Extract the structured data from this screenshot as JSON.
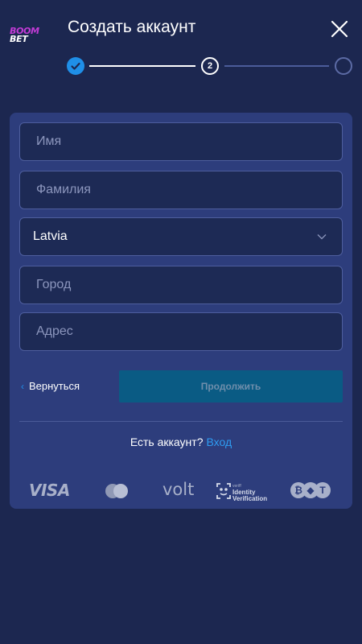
{
  "logo": {
    "line1": "BOOM",
    "line2": "BET"
  },
  "header": {
    "title": "Создать аккаунт",
    "close_icon": "close-icon"
  },
  "stepper": {
    "current_step": "2",
    "total_steps": 3,
    "completed_steps": 1
  },
  "form": {
    "first_name": {
      "placeholder": "Имя",
      "value": ""
    },
    "last_name": {
      "placeholder": "Фамилия",
      "value": ""
    },
    "country": {
      "value": "Latvia"
    },
    "city": {
      "placeholder": "Город",
      "value": ""
    },
    "address": {
      "placeholder": "Адрес",
      "value": ""
    }
  },
  "actions": {
    "back_label": "Вернуться",
    "continue_label": "Продолжить"
  },
  "login_prompt": {
    "question": "Есть аккаунт?",
    "link": "Вход"
  },
  "payments": {
    "visa": "VISA",
    "volt": "volt",
    "idv_small": "veriff",
    "idv_line1": "Identity",
    "idv_line2": "Verification"
  },
  "colors": {
    "background": "#1c2750",
    "card": "#2d3d7c",
    "accent": "#1f8fe8",
    "button": "#0a5b84",
    "link": "#2e9cf2"
  }
}
